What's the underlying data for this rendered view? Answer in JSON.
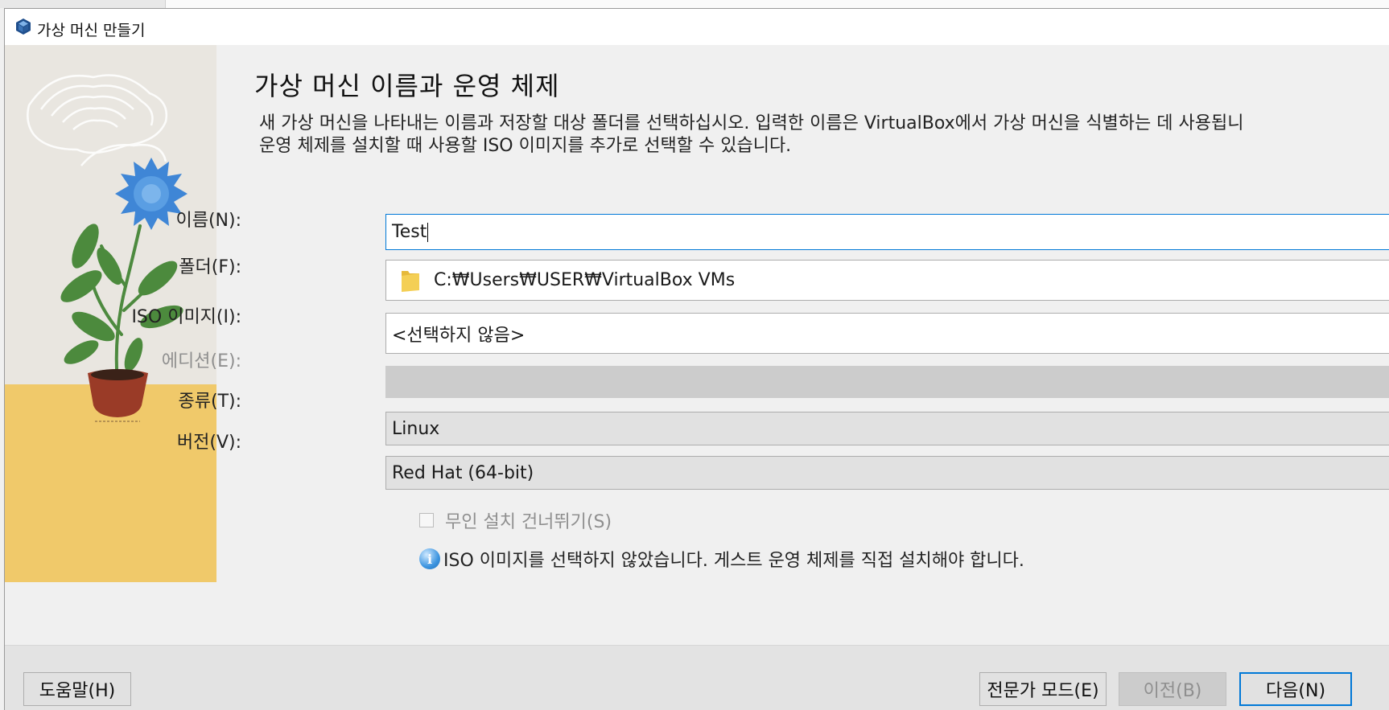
{
  "window": {
    "title": "가상 머신 만들기"
  },
  "page": {
    "heading": "가상 머신 이름과 운영 체제",
    "description_line1": "새 가상 머신을 나타내는 이름과 저장할 대상 폴더를 선택하십시오. 입력한 이름은 VirtualBox에서 가상 머신을 식별하는 데 사용됩니",
    "description_line2": "운영 체제를 설치할 때 사용할 ISO 이미지를 추가로 선택할 수 있습니다."
  },
  "form": {
    "name_label": "이름(N):",
    "name_value": "Test",
    "folder_label": "폴더(F):",
    "folder_value": "C:₩Users₩USER₩VirtualBox VMs",
    "iso_label": "ISO 이미지(I):",
    "iso_value": "<선택하지 않음>",
    "edition_label": "에디션(E):",
    "edition_value": "",
    "type_label": "종류(T):",
    "type_value": "Linux",
    "version_label": "버전(V):",
    "version_value": "Red Hat (64-bit)",
    "skip_unattended_label": "무인 설치 건너뛰기(S)",
    "skip_unattended_checked": false,
    "info_message": "ISO 이미지를 선택하지 않았습니다. 게스트 운영 체제를 직접 설치해야 합니다."
  },
  "buttons": {
    "help": "도움말(H)",
    "expert_mode": "전문가 모드(E)",
    "back": "이전(B)",
    "next": "다음(N)"
  },
  "icons": {
    "app": "virtualbox-icon",
    "folder": "folder-icon",
    "info": "info-icon"
  },
  "colors": {
    "focus_border": "#0078d7",
    "dialog_bg": "#f0f0f0",
    "illustration_floor": "#f0c96a",
    "flower": "#3f86d6"
  }
}
